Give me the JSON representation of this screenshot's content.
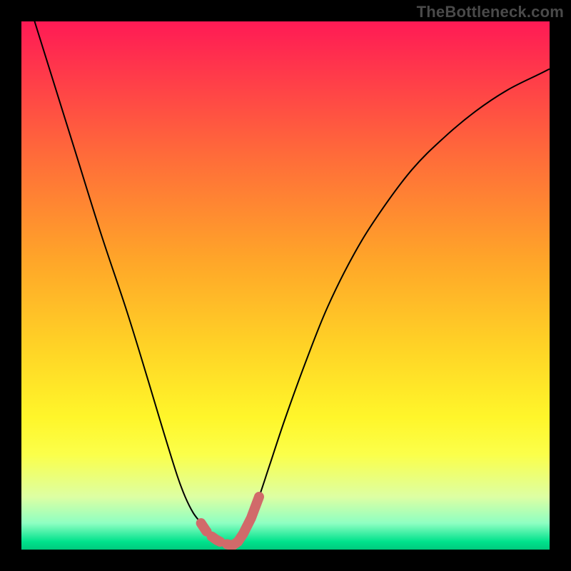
{
  "watermark": "TheBottleneck.com",
  "chart_data": {
    "type": "line",
    "title": "",
    "xlabel": "",
    "ylabel": "",
    "xlim": [
      0,
      100
    ],
    "ylim": [
      0,
      100
    ],
    "series": [
      {
        "name": "left-curve",
        "x": [
          0,
          5,
          10,
          15,
          20,
          24,
          27,
          29.5,
          31,
          32.5,
          34,
          35,
          36,
          37,
          38,
          39,
          40
        ],
        "y": [
          108,
          92,
          76,
          60,
          45,
          32,
          22,
          14,
          10,
          7,
          5,
          3.5,
          2.5,
          1.8,
          1.3,
          1.0,
          0.8
        ]
      },
      {
        "name": "right-curve",
        "x": [
          40,
          41,
          42,
          43.5,
          45,
          47,
          50,
          54,
          58,
          63,
          68,
          74,
          80,
          86,
          92,
          98,
          100
        ],
        "y": [
          0.8,
          1.5,
          3,
          6,
          10,
          16,
          25,
          36,
          46,
          56,
          64,
          72,
          78,
          83,
          87,
          90,
          91
        ]
      }
    ],
    "marker": {
      "name": "highlight-segment",
      "color": "#d16a6a",
      "x": [
        34,
        35,
        36,
        37,
        38,
        39,
        40,
        41,
        42,
        43.5,
        45
      ],
      "y": [
        5,
        3.5,
        2.5,
        1.8,
        1.3,
        1.0,
        0.8,
        1.5,
        3,
        6,
        10
      ]
    },
    "background_gradient": {
      "top": "#ff1a55",
      "mid": "#fff62a",
      "bottom": "#00c97d"
    }
  }
}
